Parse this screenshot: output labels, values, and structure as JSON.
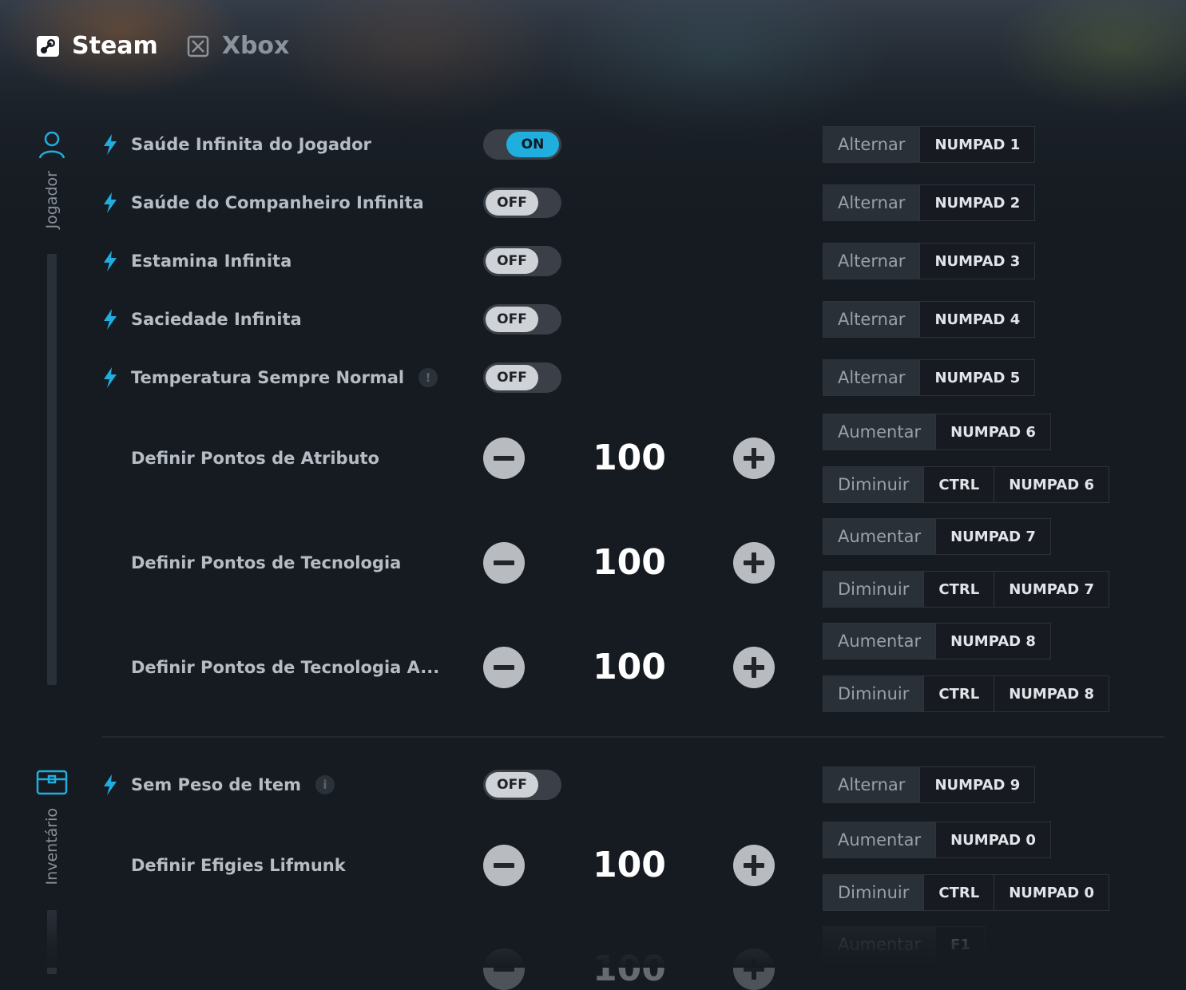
{
  "platforms": [
    {
      "label": "Steam",
      "active": true
    },
    {
      "label": "Xbox",
      "active": false
    }
  ],
  "sections": {
    "player": "Jogador",
    "inventory": "Inventário"
  },
  "cheats": {
    "c1": {
      "label": "Saúde Infinita do Jogador",
      "state": "ON",
      "action": "Alternar",
      "key": "NUMPAD 1"
    },
    "c2": {
      "label": "Saúde do Companheiro Infinita",
      "state": "OFF",
      "action": "Alternar",
      "key": "NUMPAD 2"
    },
    "c3": {
      "label": "Estamina Infinita",
      "state": "OFF",
      "action": "Alternar",
      "key": "NUMPAD 3"
    },
    "c4": {
      "label": "Saciedade Infinita",
      "state": "OFF",
      "action": "Alternar",
      "key": "NUMPAD 4"
    },
    "c5": {
      "label": "Temperatura Sempre Normal",
      "info": "!",
      "state": "OFF",
      "action": "Alternar",
      "key": "NUMPAD 5"
    },
    "s1": {
      "label": "Definir Pontos de Atributo",
      "value": "100",
      "inc": {
        "action": "Aumentar",
        "key": "NUMPAD 6"
      },
      "dec": {
        "action": "Diminuir",
        "mod": "CTRL",
        "key": "NUMPAD 6"
      }
    },
    "s2": {
      "label": "Definir Pontos de Tecnologia",
      "value": "100",
      "inc": {
        "action": "Aumentar",
        "key": "NUMPAD 7"
      },
      "dec": {
        "action": "Diminuir",
        "mod": "CTRL",
        "key": "NUMPAD 7"
      }
    },
    "s3": {
      "label": "Definir Pontos de Tecnologia A...",
      "value": "100",
      "inc": {
        "action": "Aumentar",
        "key": "NUMPAD 8"
      },
      "dec": {
        "action": "Diminuir",
        "mod": "CTRL",
        "key": "NUMPAD 8"
      }
    },
    "c6": {
      "label": "Sem Peso de Item",
      "info": "i",
      "state": "OFF",
      "action": "Alternar",
      "key": "NUMPAD 9"
    },
    "s4": {
      "label": "Definir Efigies Lifmunk",
      "value": "100",
      "inc": {
        "action": "Aumentar",
        "key": "NUMPAD 0"
      },
      "dec": {
        "action": "Diminuir",
        "mod": "CTRL",
        "key": "NUMPAD 0"
      }
    },
    "s5": {
      "value": "100",
      "inc": {
        "action": "Aumentar",
        "key": "F1"
      }
    }
  },
  "colors": {
    "accent": "#20aede",
    "background": "#161b22"
  }
}
